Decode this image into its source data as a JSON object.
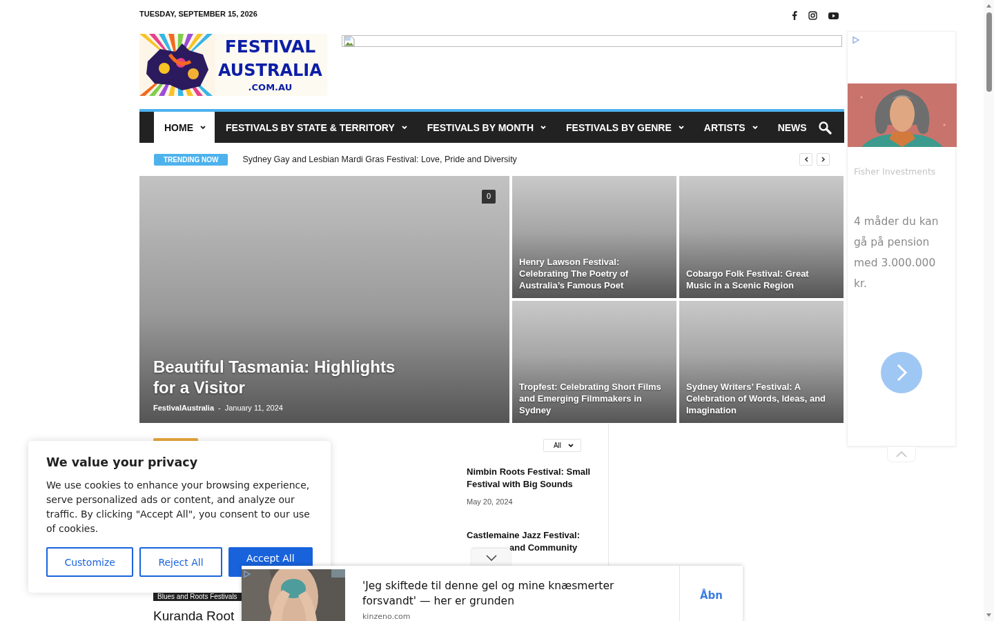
{
  "top_bar": {
    "date": "TUESDAY, SEPTEMBER 15, 2026",
    "social": [
      {
        "kind": "facebook"
      },
      {
        "kind": "instagram"
      },
      {
        "kind": "youtube"
      }
    ]
  },
  "logo": {
    "line1": "FESTIVAL",
    "line2": "AUSTRALIA",
    "line3": ".COM.AU"
  },
  "nav": {
    "items": [
      {
        "label": "HOME",
        "selected": true,
        "dropdown": true
      },
      {
        "label": "FESTIVALS BY STATE & TERRITORY",
        "selected": false,
        "dropdown": true
      },
      {
        "label": "FESTIVALS BY MONTH",
        "selected": false,
        "dropdown": true
      },
      {
        "label": "FESTIVALS BY GENRE",
        "selected": false,
        "dropdown": true
      },
      {
        "label": "ARTISTS",
        "selected": false,
        "dropdown": true
      },
      {
        "label": "NEWS",
        "selected": false,
        "dropdown": false
      }
    ]
  },
  "trending": {
    "label": "TRENDING NOW",
    "headline": "Sydney Gay and Lesbian Mardi Gras Festival: Love, Pride and Diversity"
  },
  "hero": {
    "main": {
      "title": "Beautiful Tasmania: Highlights for a Visitor",
      "author": "FestivalAustralia",
      "separator": "-",
      "date": "January 11, 2024",
      "comments": "0"
    },
    "tiles": [
      {
        "title": "Henry Lawson Festival: Celebrating The Poetry of Australia’s Famous Poet"
      },
      {
        "title": "Cobargo Folk Festival: Great Music in a Scenic Region"
      },
      {
        "title": "Tropfest: Celebrating Short Films and Emerging Filmmakers in Sydney"
      },
      {
        "title": "Sydney Writers’ Festival: A Celebration of Words, Ideas, and Imagination"
      }
    ]
  },
  "block": {
    "filter": "All",
    "posts": [
      {
        "title": "Nimbin Roots Festival: Small Festival with Big Sounds",
        "date": "May 20, 2024"
      },
      {
        "title": "Castlemaine Jazz Festival:",
        "title_continued": "and Community"
      }
    ],
    "featured": {
      "category": "Blues and Roots Festivals",
      "title": "Kuranda Root"
    }
  },
  "side_ad": {
    "advertiser": "Fisher Investments",
    "headline": "4 måder du kan gå på pension med 3.000.000 kr."
  },
  "cookie_banner": {
    "title": "We value your privacy",
    "text": "We use cookies to enhance your browsing experience, serve personalized ads or content, and analyze our traffic. By clicking \"Accept All\", you consent to our use of cookies.",
    "buttons": [
      {
        "label": "Customize",
        "kind": "outline"
      },
      {
        "label": "Reject All",
        "kind": "outline"
      },
      {
        "label": "Accept All",
        "kind": "primary"
      }
    ]
  },
  "bottom_ad": {
    "headline": "'Jeg skiftede til denne gel og mine knæsmerter forsvandt' — her er grunden",
    "source": "kinzeno.com",
    "action": "Åbn"
  }
}
